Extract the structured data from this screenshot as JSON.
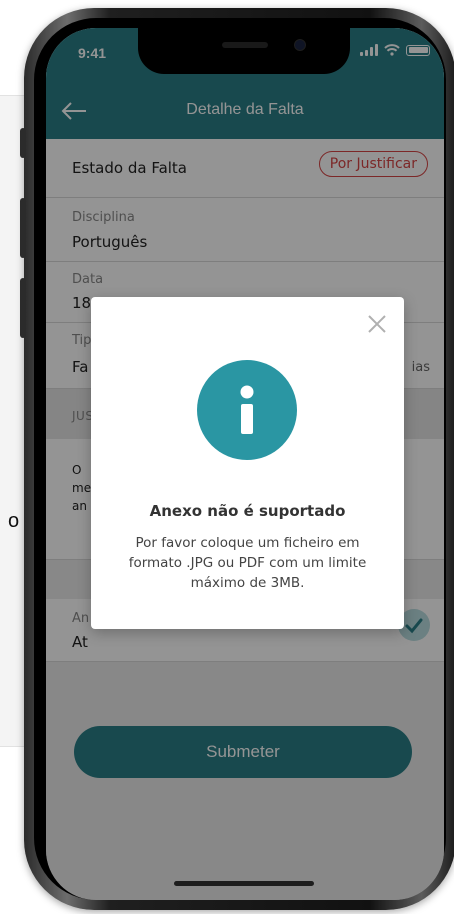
{
  "background": {
    "fragment_text": "o"
  },
  "statusbar": {
    "time": "9:41"
  },
  "appbar": {
    "title": "Detalhe da Falta"
  },
  "estado": {
    "label": "Estado da Falta",
    "badge": "Por Justificar"
  },
  "disciplina": {
    "label": "Disciplina",
    "value": "Português"
  },
  "data": {
    "label": "Data",
    "value": "18"
  },
  "tipo": {
    "label": "Tip",
    "value": "Fa",
    "right_value": "ias"
  },
  "justificacao": {
    "header": "JUS",
    "lines": [
      "O",
      "me",
      "an"
    ]
  },
  "anexo": {
    "label": "An",
    "value": "At"
  },
  "submit": {
    "label": "Submeter"
  },
  "modal": {
    "title": "Anexo não é suportado",
    "body": "Por favor coloque um ficheiro em formato .JPG ou PDF com um limite máximo de 3MB."
  },
  "colors": {
    "brand": "#2a7f87",
    "accent": "#2a96a3",
    "badge": "#d64545"
  },
  "icons": [
    "back-arrow-icon",
    "wifi-icon",
    "signal-icon",
    "battery-icon",
    "close-icon",
    "info-icon",
    "checkmark-icon"
  ]
}
